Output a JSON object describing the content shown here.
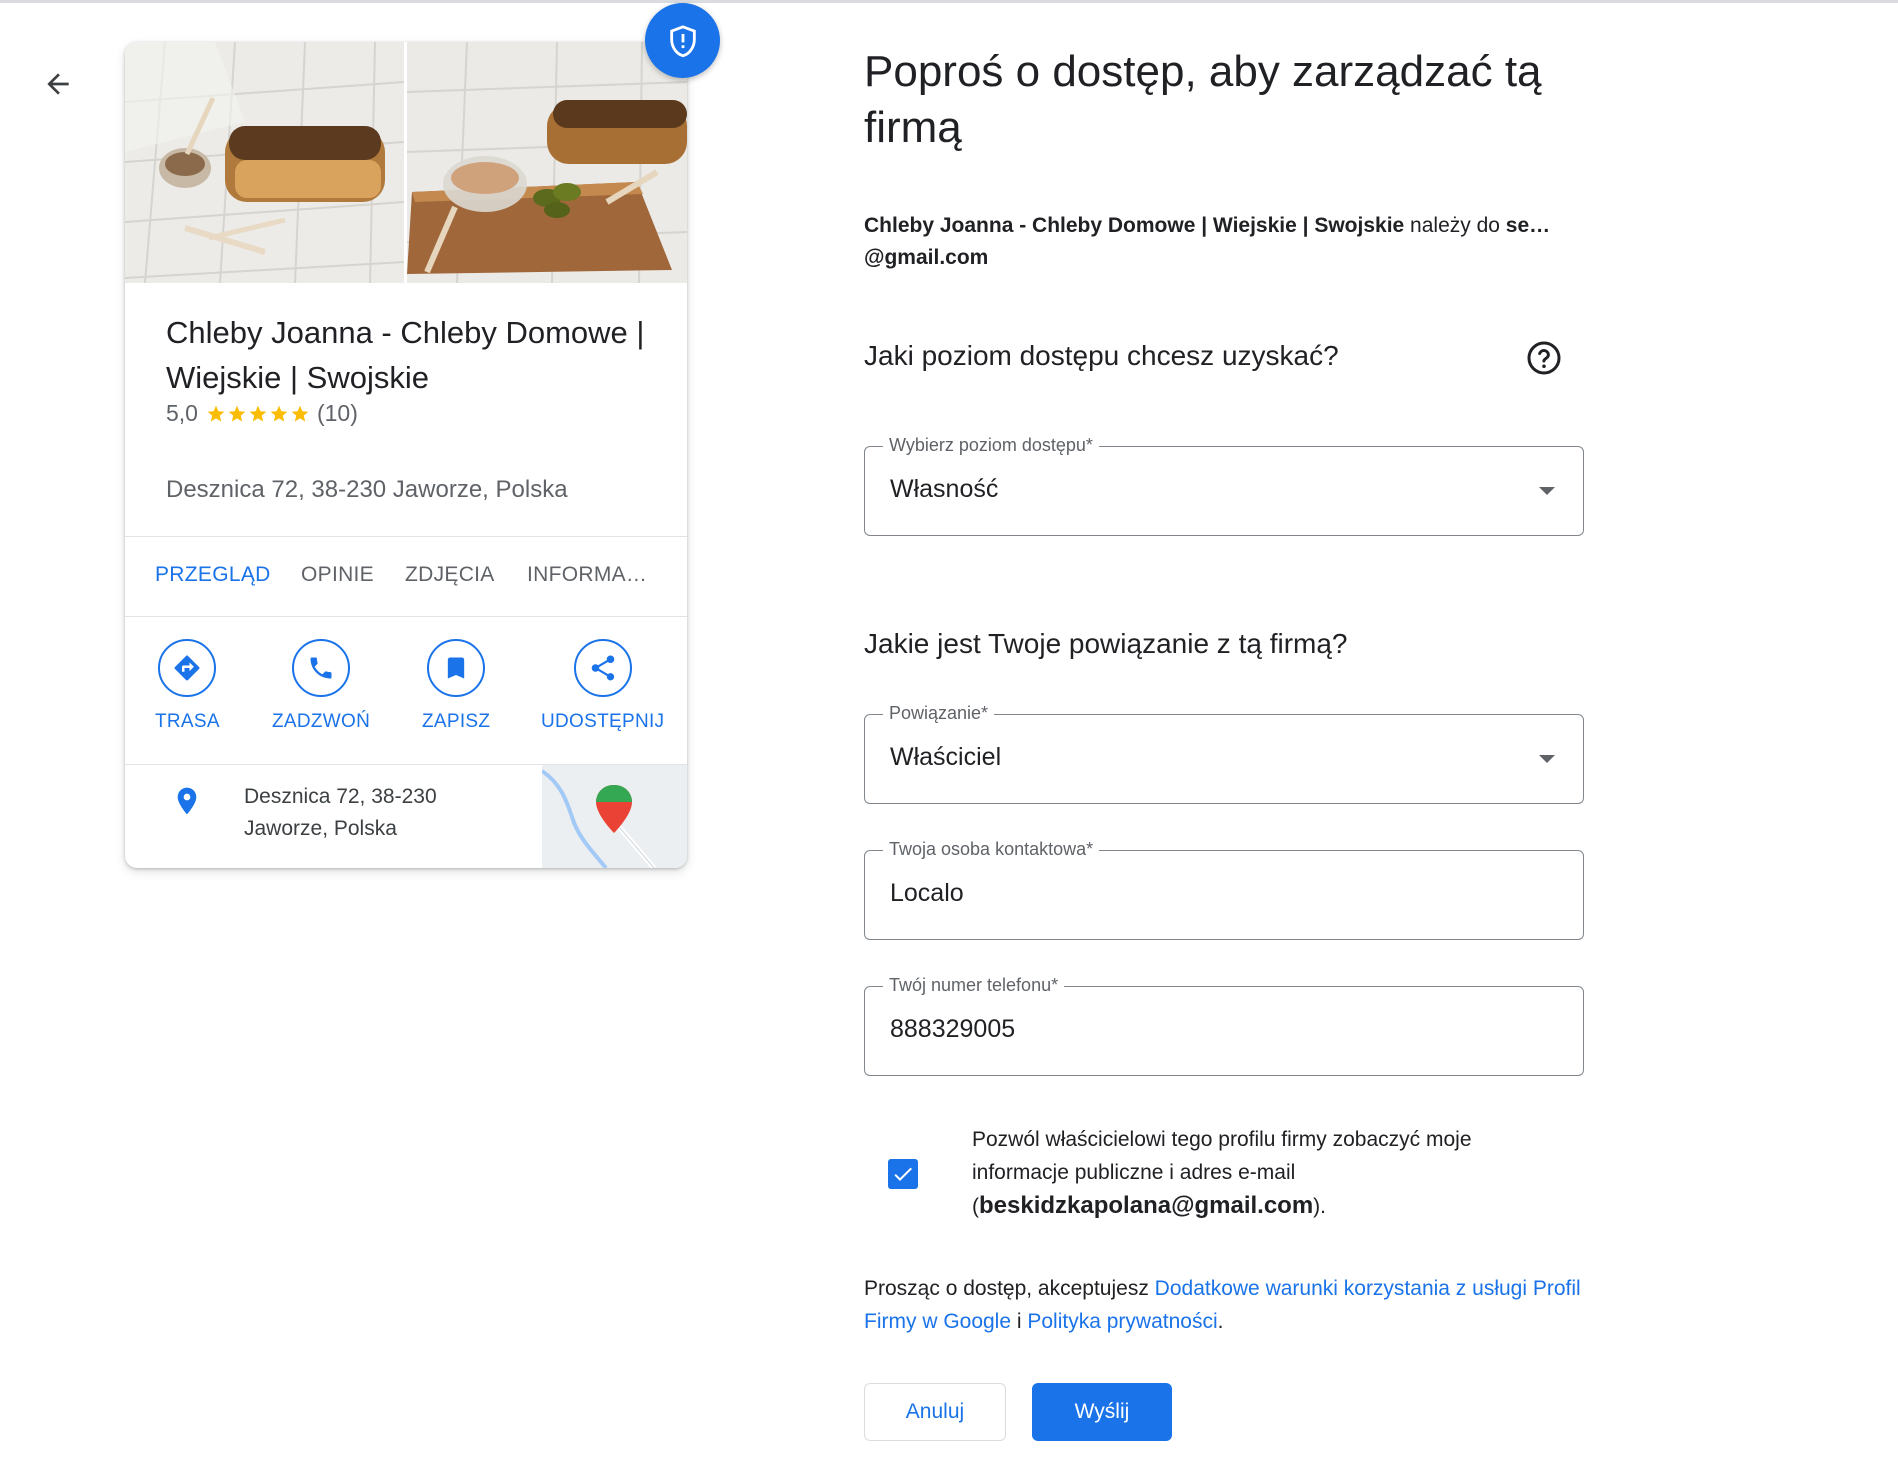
{
  "colors": {
    "accent": "#1a73e8",
    "star": "#fbbc04",
    "text": "#202124",
    "muted": "#5f6368"
  },
  "icons": {
    "back": "arrow-left-icon",
    "badge": "shield-icon",
    "help": "help-circle-icon",
    "directions": "directions-icon",
    "call": "phone-icon",
    "save": "bookmark-icon",
    "share": "share-icon",
    "location": "location-pin-icon",
    "checkbox": "check-icon"
  },
  "business": {
    "name": "Chleby Joanna - Chleby Domowe | Wiejskie | Swojskie",
    "rating": "5,0",
    "star_count": 5,
    "reviews": "(10)",
    "address": "Desznica 72, 38-230 Jaworze, Polska",
    "tabs": [
      "PRZEGLĄD",
      "OPINIE",
      "ZDJĘCIA",
      "INFORMA…"
    ],
    "actions": [
      "TRASA",
      "ZADZWOŃ",
      "ZAPISZ",
      "UDOSTĘPNIJ"
    ],
    "location_line1": "Desznica 72, 38-230",
    "location_line2": "Jaworze, Polska"
  },
  "form": {
    "title": "Poproś o dostęp, aby zarządzać tą firmą",
    "owner_business": "Chleby Joanna - Chleby Domowe | Wiejskie | Swojskie",
    "owner_mid": " należy do ",
    "owner_email_start": "se…",
    "owner_email_end": "@gmail.com",
    "question_access": "Jaki poziom dostępu chcesz uzyskać?",
    "access_label": "Wybierz poziom dostępu*",
    "access_value": "Własność",
    "question_relation": "Jakie jest Twoje powiązanie z tą firmą?",
    "relation_label": "Powiązanie*",
    "relation_value": "Właściciel",
    "contact_label": "Twoja osoba kontaktowa*",
    "contact_value": "Localo",
    "phone_label": "Twój numer telefonu*",
    "phone_value": "888329005",
    "consent_checked": true,
    "consent_text": "Pozwól właścicielowi tego profilu firmy zobaczyć moje informacje publiczne i adres e-mail",
    "consent_open": "(",
    "consent_email": "beskidzkapolana@gmail.com",
    "consent_close": ").",
    "terms_prefix": "Prosząc o dostęp, akceptujesz ",
    "terms_link1": "Dodatkowe warunki korzystania z usługi Profil Firmy w Google",
    "terms_mid": " i ",
    "terms_link2": "Polityka prywatności",
    "terms_suffix": ".",
    "cancel_label": "Anuluj",
    "send_label": "Wyślij"
  }
}
